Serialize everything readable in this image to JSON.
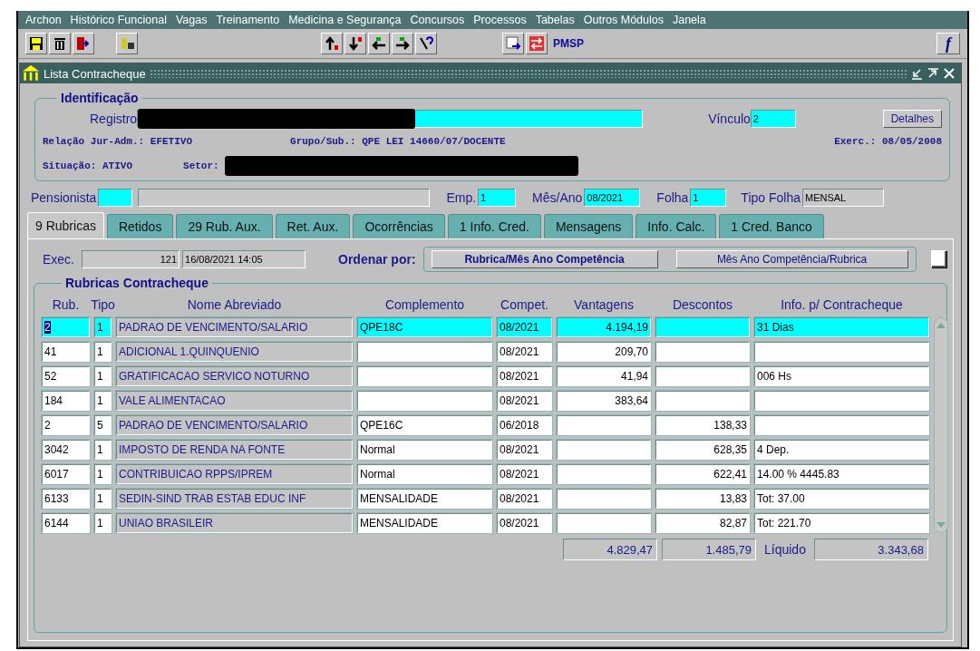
{
  "menu": [
    "Archon",
    "Histórico Funcional",
    "Vagas",
    "Treinamento",
    "Medicina e Segurança",
    "Concursos",
    "Processos",
    "Tabelas",
    "Outros Módulos",
    "Janela"
  ],
  "toolbar": {
    "label": "PMSP",
    "function_button": "f"
  },
  "window": {
    "title": "Lista Contracheque"
  },
  "identificacao": {
    "title": "Identificação",
    "registro_label": "Registro",
    "vinculo_label": "Vínculo",
    "vinculo": "2",
    "details_button": "Detalhes",
    "relacao": "Relação Jur-Adm.: EFETIVO",
    "grupo": "Grupo/Sub.: QPE LEI 14660/07/DOCENTE",
    "exercicio": "Exerc.: 08/05/2008",
    "situacao": "Situação: ATIVO",
    "setor_label": "Setor:"
  },
  "header": {
    "pensionista_label": "Pensionista",
    "emp_label": "Emp.",
    "emp": "1",
    "mes_ano_label": "Mês/Ano",
    "mes_ano": "08/2021",
    "folha_label": "Folha",
    "folha": "1",
    "tipo_folha_label": "Tipo Folha",
    "tipo_folha": "MENSAL"
  },
  "tabs": [
    {
      "label": "9 Rubricas",
      "selected": true
    },
    {
      "label": "Retidos",
      "selected": false
    },
    {
      "label": "29 Rub. Aux.",
      "selected": false
    },
    {
      "label": "Ret. Aux.",
      "selected": false
    },
    {
      "label": "Ocorrências",
      "selected": false
    },
    {
      "label": "1 Info. Cred.",
      "selected": false
    },
    {
      "label": "Mensagens",
      "selected": false
    },
    {
      "label": "Info. Calc.",
      "selected": false
    },
    {
      "label": "1 Cred. Banco",
      "selected": false
    }
  ],
  "exec": {
    "label": "Exec.",
    "count": "121",
    "datetime": "16/08/2021 14:05"
  },
  "sort": {
    "label": "Ordenar por:",
    "options": [
      {
        "label": "Rubrica/Mês Ano Competência",
        "selected": true
      },
      {
        "label": "Mês Ano Competência/Rubrica",
        "selected": false
      }
    ]
  },
  "table": {
    "title": "Rubricas Contracheque",
    "columns": [
      "Rub.",
      "Tipo",
      "Nome Abreviado",
      "Complemento",
      "Compet.",
      "Vantagens",
      "Descontos",
      "Info. p/ Contracheque"
    ],
    "rows": [
      {
        "rub": "2",
        "tipo": "1",
        "nome": "PADRAO DE VENCIMENTO/SALARIO",
        "complemento": "QPE18C",
        "compet": "08/2021",
        "vantagens": "4.194,19",
        "info": "31 Dias",
        "selected": true
      },
      {
        "rub": "41",
        "tipo": "1",
        "nome": "ADICIONAL 1.QUINQUENIO",
        "compet": "08/2021",
        "vantagens": "209,70",
        "selected": false
      },
      {
        "rub": "52",
        "tipo": "1",
        "nome": "GRATIFICACAO SERVICO NOTURNO",
        "compet": "08/2021",
        "vantagens": "41,94",
        "info": "006 Hs",
        "selected": false
      },
      {
        "rub": "184",
        "tipo": "1",
        "nome": "VALE ALIMENTACAO",
        "compet": "08/2021",
        "vantagens": "383,64",
        "selected": false
      },
      {
        "rub": "2",
        "tipo": "5",
        "nome": "PADRAO DE VENCIMENTO/SALARIO",
        "complemento": "QPE16C",
        "compet": "06/2018",
        "descontos": "138,33",
        "selected": false
      },
      {
        "rub": "3042",
        "tipo": "1",
        "nome": "IMPOSTO DE RENDA NA FONTE",
        "complemento": "Normal",
        "compet": "08/2021",
        "descontos": "628,35",
        "info": "4 Dep.",
        "selected": false
      },
      {
        "rub": "6017",
        "tipo": "1",
        "nome": "CONTRIBUICAO RPPS/IPREM",
        "complemento": "Normal",
        "compet": "08/2021",
        "descontos": "622,41",
        "info": "14.00 % 4445.83",
        "selected": false
      },
      {
        "rub": "6133",
        "tipo": "1",
        "nome": "SEDIN-SIND TRAB ESTAB EDUC INF",
        "complemento": "MENSALIDADE",
        "compet": "08/2021",
        "descontos": "13,83",
        "info": "Tot: 37.00",
        "selected": false
      },
      {
        "rub": "6144",
        "tipo": "1",
        "nome": "UNIAO BRASILEIR",
        "complemento": "MENSALIDADE",
        "compet": "08/2021",
        "descontos": "82,87",
        "info": "Tot: 221.70",
        "selected": false
      }
    ]
  },
  "totals": {
    "vantagens": "4.829,47",
    "descontos": "1.485,79",
    "liquido_label": "Líquido",
    "liquido": "3.343,68"
  }
}
